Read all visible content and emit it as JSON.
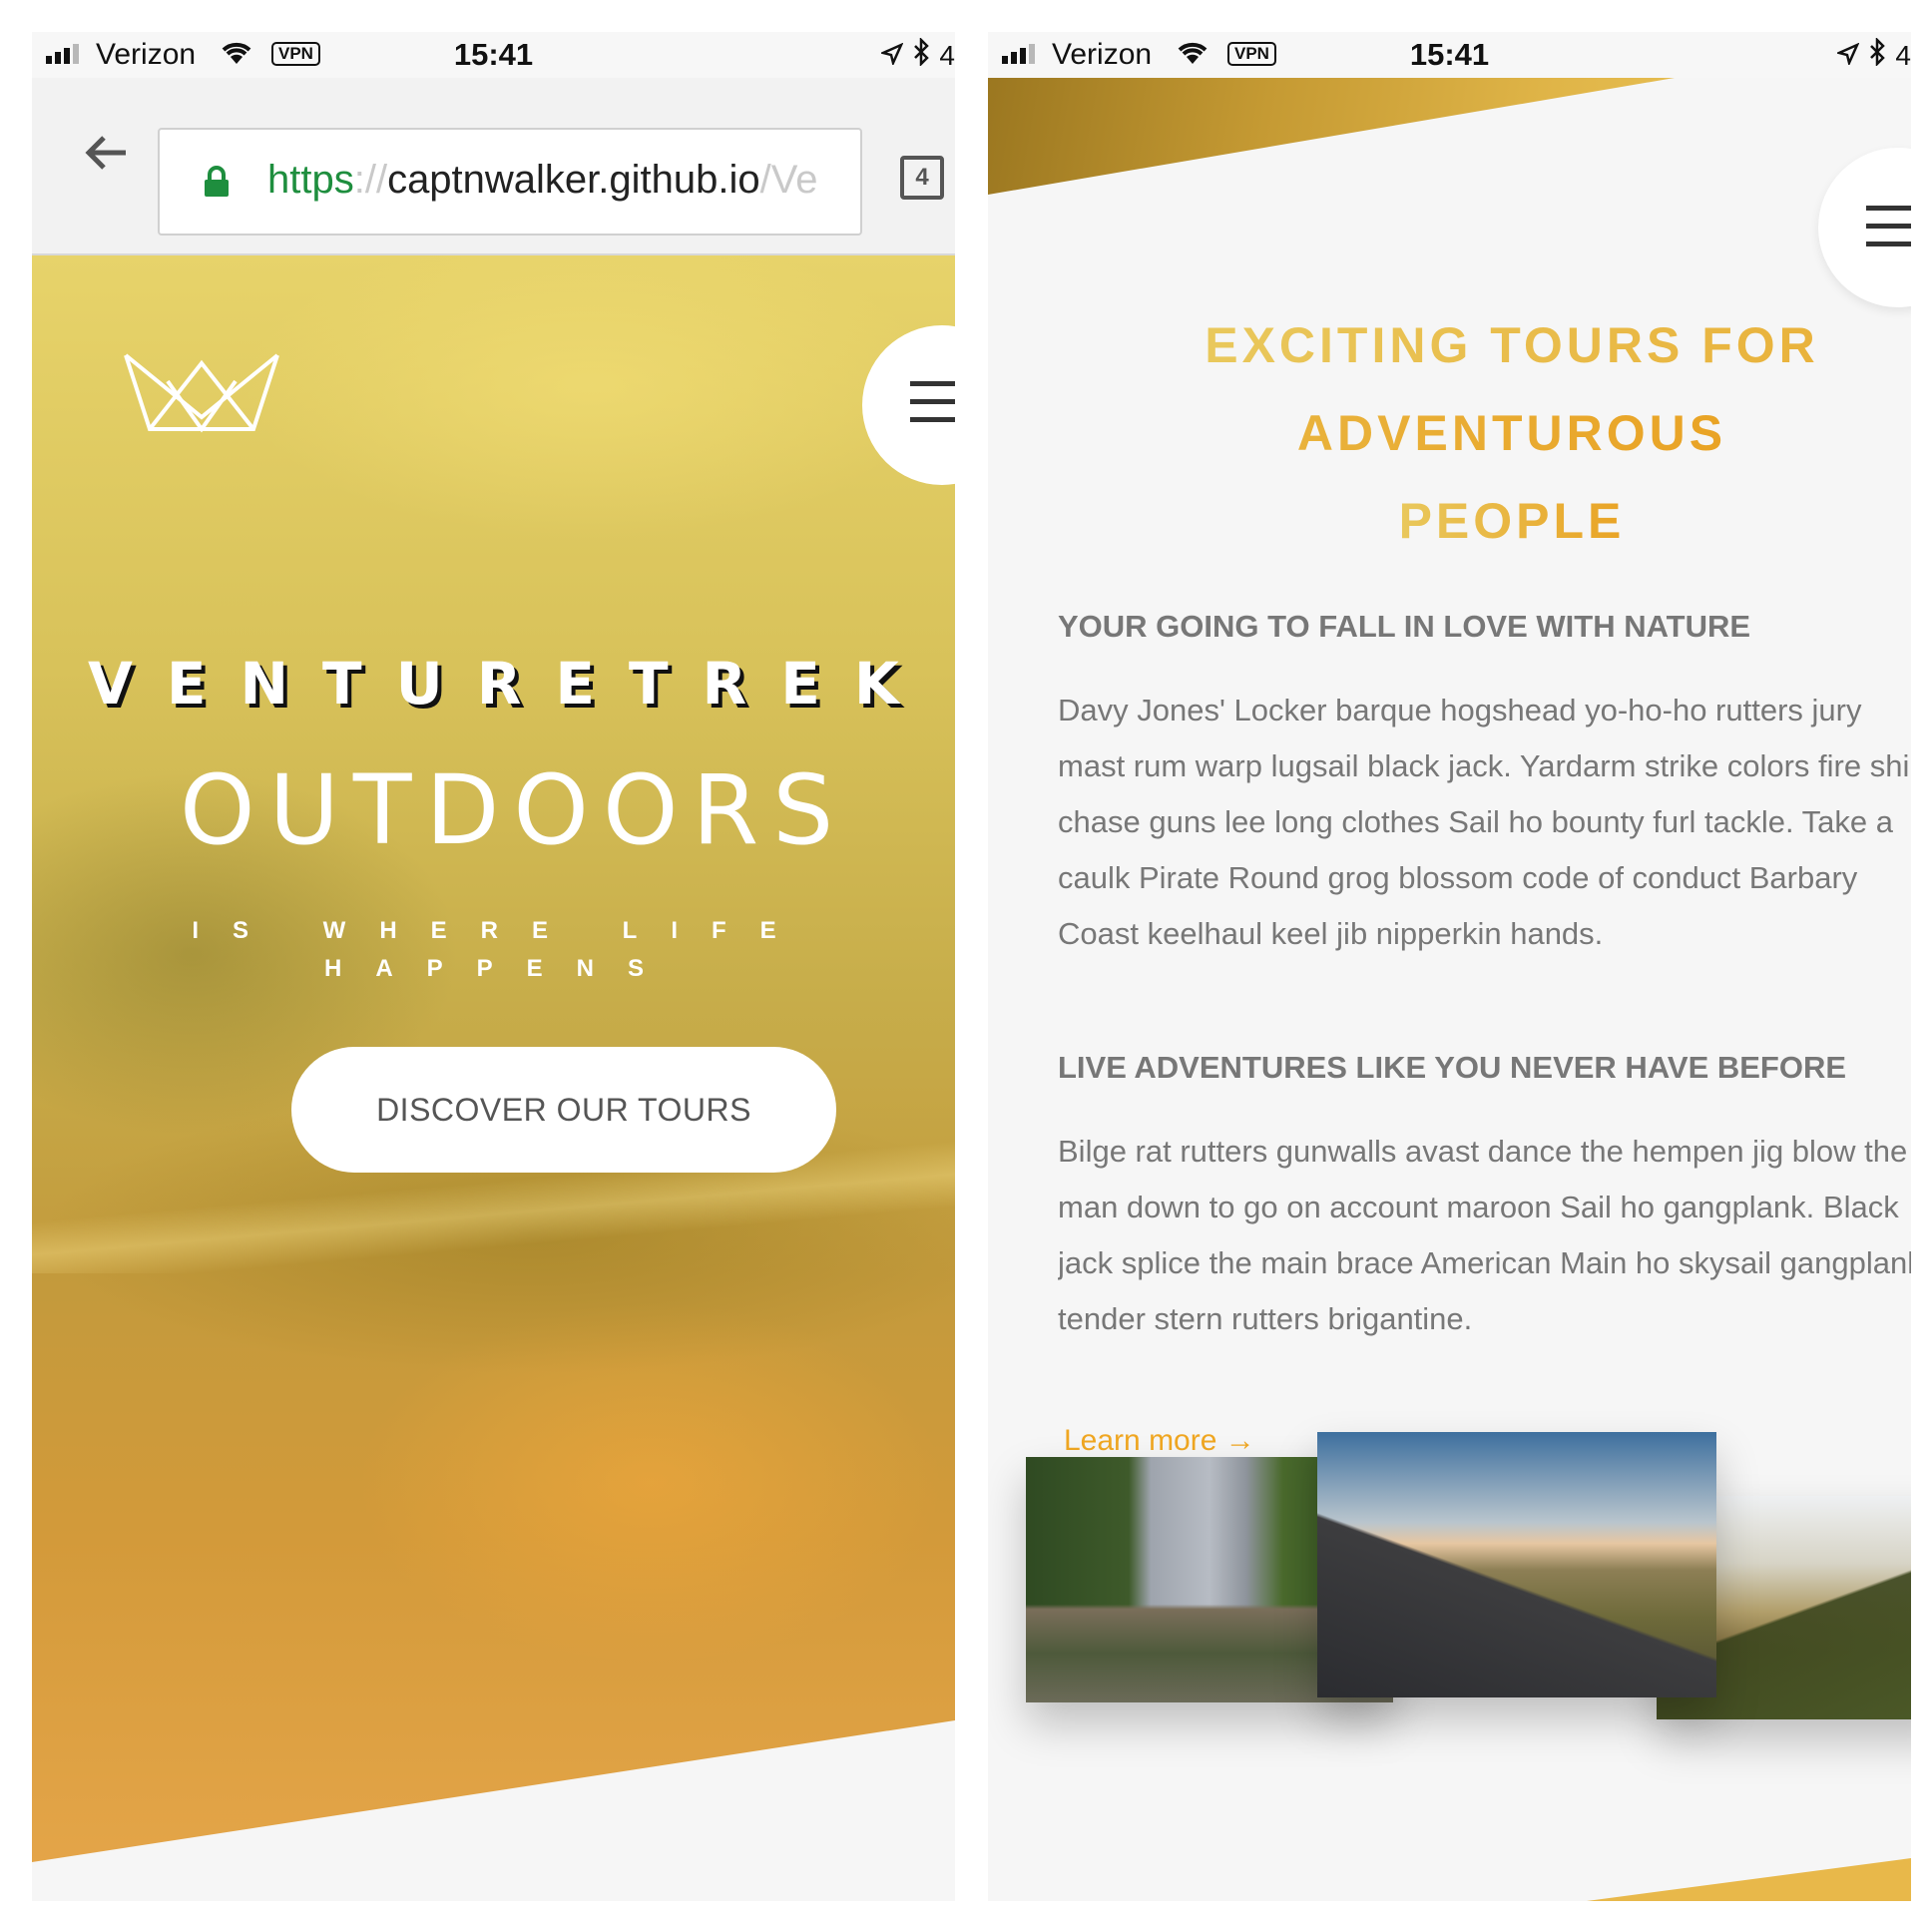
{
  "status_bar": {
    "carrier": "Verizon",
    "vpn_label": "VPN",
    "time": "15:41",
    "battery_fragment": "4"
  },
  "browser": {
    "url_scheme": "https",
    "url_separator": "://",
    "url_host": "captnwalker.github.io",
    "url_path_fragment": "/Ve",
    "tab_count": "4"
  },
  "hero": {
    "brand": "VENTURETREK",
    "headline": "OUTDOORS",
    "tagline_line1": "IS WHERE LIFE",
    "tagline_line2": "HAPPENS",
    "cta_label": "DISCOVER OUR TOURS"
  },
  "tours": {
    "title_line1": "EXCITING TOURS FOR ADVENTUROUS",
    "title_line2": "PEOPLE",
    "heading1": "YOUR GOING TO FALL IN LOVE WITH NATURE",
    "paragraph1": "Davy Jones' Locker barque hogshead yo-ho-ho rutters jury\nmast rum warp lugsail black jack. Yardarm strike colors fire ship\nchase guns lee long clothes Sail ho bounty furl tackle. Take a\ncaulk Pirate Round grog blossom code of conduct Barbary\nCoast keelhaul keel jib nipperkin hands.",
    "heading2": "LIVE ADVENTURES LIKE YOU NEVER HAVE BEFORE",
    "paragraph2": "Bilge rat rutters gunwalls avast dance the hempen jig blow the\nman down to go on account maroon Sail ho gangplank. Black\njack splice the main brace American Main ho skysail gangplank\ntender stern rutters brigantine.",
    "learn_more": "Learn more →"
  },
  "colors": {
    "accent_gold": "#e6ab2e",
    "link_orange": "#f0a722",
    "url_green": "#1e8e3e",
    "body_text": "#777777"
  },
  "icons": [
    "signal-icon",
    "wifi-icon",
    "vpn-icon",
    "location-icon",
    "bluetooth-icon",
    "back-arrow-icon",
    "lock-icon",
    "tabs-icon",
    "crown-logo-icon",
    "hamburger-menu-icon"
  ]
}
